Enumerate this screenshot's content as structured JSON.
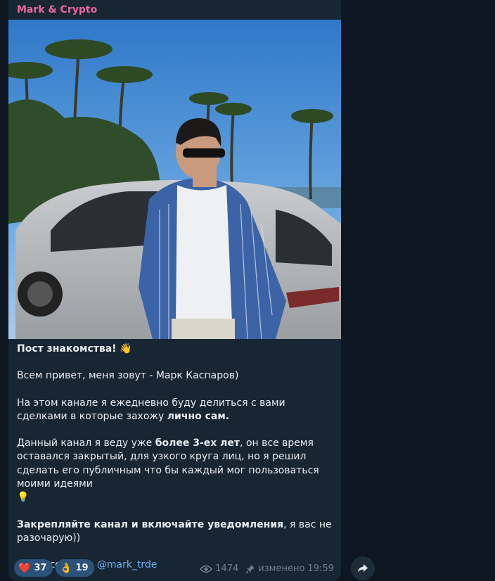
{
  "channel": {
    "name": "Mark & Crypto",
    "name_color": "#e9699e"
  },
  "post": {
    "title": "Пост знакомства!",
    "title_emoji": "👋",
    "greeting": "Всем привет, меня зовут - Марк Каспаров)",
    "p2_a": "На этом канале я ежедневно буду делиться с вами сделками в которые захожу ",
    "p2_bold": "лично сам.",
    "p3_a": "Данный канал я веду уже ",
    "p3_bold": "более 3-ех лет",
    "p3_b": ", он все время оставался закрытый, для узкого круга лиц, но я решил сделать его публичным что бы каждый мог пользоваться моими идеями",
    "p3_emoji": "💡",
    "p4_bold": "Закрепляйте канал и включайте уведомления",
    "p4_b": ", я вас не разочарую))",
    "contact_label": "Связь со мной: ",
    "contact_link": "@mark_trde"
  },
  "reactions": [
    {
      "emoji": "❤️",
      "count": "37"
    },
    {
      "emoji": "👌",
      "count": "19"
    }
  ],
  "meta": {
    "views_icon": "eye-icon",
    "views": "1474",
    "pin_icon": "pin-icon",
    "edited": "изменено 19:59"
  },
  "share_icon": "share-arrow-icon",
  "colors": {
    "bg": "#0e1621",
    "bubble": "#182533",
    "link": "#6ab3f3",
    "reaction_bg": "#2b5278"
  }
}
